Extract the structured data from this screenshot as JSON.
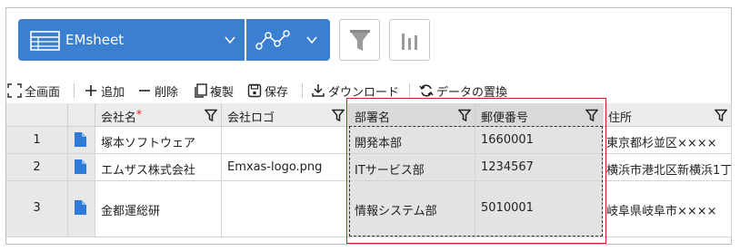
{
  "header": {
    "sheet_name": "EMsheet",
    "sheet_icon": "table-icon",
    "view_icon": "line-chart-icon",
    "filter_icon": "funnel-icon",
    "chart_icon": "bar-chart-icon"
  },
  "toolbar": {
    "fullscreen": "全画面",
    "add": "追加",
    "delete": "削除",
    "copy": "複製",
    "save": "保存",
    "download": "ダウンロード",
    "replace": "データの置換"
  },
  "columns": [
    "会社名",
    "会社ロゴ",
    "部署名",
    "郵便番号",
    "住所"
  ],
  "required_marker": "*",
  "rows": [
    {
      "num": "1",
      "company": "塚本ソフトウェア",
      "logo": "",
      "dept": "開発本部",
      "zip": "1660001",
      "address": "東京都杉並区××××"
    },
    {
      "num": "2",
      "company": "エムザス株式会社",
      "logo": "Emxas-logo.png",
      "dept": "ITサービス部",
      "zip": "1234567",
      "address": "横浜市港北区新横浜1丁"
    },
    {
      "num": "3",
      "company": "金都運総研",
      "logo": "",
      "dept": "情報システム部",
      "zip": "5010001",
      "address": "岐阜県岐阜市××××"
    }
  ],
  "colors": {
    "accent": "#3b7fd0",
    "selection_outline": "#d21f1f",
    "doc_icon": "#2f7ad6"
  }
}
